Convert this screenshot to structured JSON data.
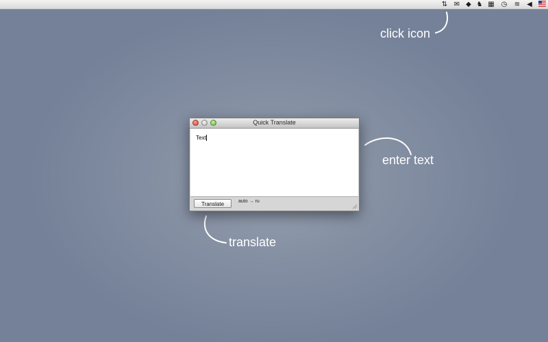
{
  "menubar": {
    "icons": [
      "transfer-icon",
      "mail-icon",
      "dropbox-icon",
      "evernote-icon",
      "grid-icon",
      "time-machine-icon",
      "wifi-icon",
      "volume-icon",
      "us-flag-icon"
    ]
  },
  "window": {
    "title": "Quick Translate",
    "text_value": "Text",
    "translate_label": "Translate",
    "language_pair": "auto → ru"
  },
  "annotations": {
    "click_icon": "click icon",
    "enter_text": "enter text",
    "translate": "translate"
  },
  "colors": {
    "annotation_text": "#ffffff",
    "close_light": "#d9382c",
    "zoom_light": "#5bb733"
  }
}
